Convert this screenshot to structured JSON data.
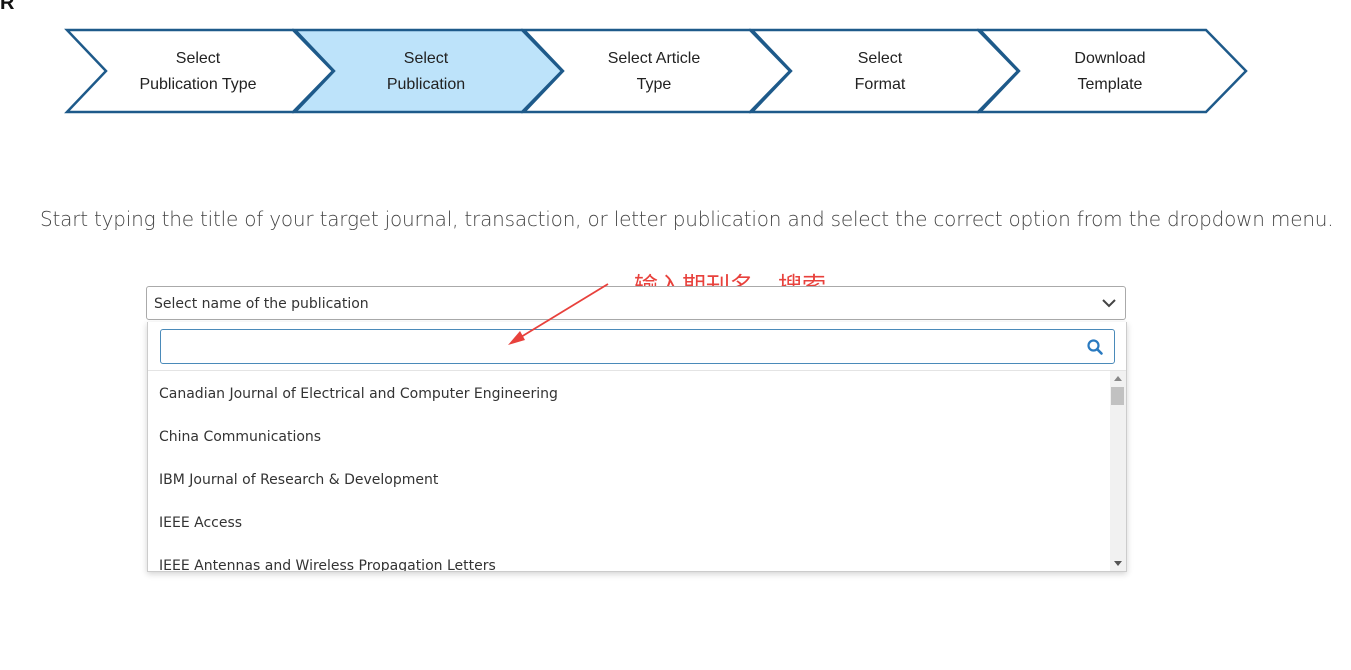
{
  "corner_glyph": "R",
  "steps": [
    {
      "line1": "Select",
      "line2": "Publication Type",
      "active": false
    },
    {
      "line1": "Select",
      "line2": "Publication",
      "active": true
    },
    {
      "line1": "Select Article",
      "line2": "Type",
      "active": false
    },
    {
      "line1": "Select",
      "line2": "Format",
      "active": false
    },
    {
      "line1": "Download",
      "line2": "Template",
      "active": false
    }
  ],
  "instructions": "Start typing the title of your target journal, transaction, or letter publication and select the correct option from the dropdown menu.",
  "annotation": "输入期刊名，搜索",
  "select": {
    "placeholder": "Select name of the publication"
  },
  "search": {
    "value": ""
  },
  "publications": [
    "Canadian Journal of Electrical and Computer Engineering",
    "China Communications",
    "IBM Journal of Research & Development",
    "IEEE Access",
    "IEEE Antennas and Wireless Propagation Letters"
  ],
  "colors": {
    "step_border": "#1e5a8a",
    "step_active_fill": "#bde3fa",
    "annotation": "#e8413c",
    "search_border": "#4a8ab9",
    "search_icon": "#2a7ac0"
  }
}
